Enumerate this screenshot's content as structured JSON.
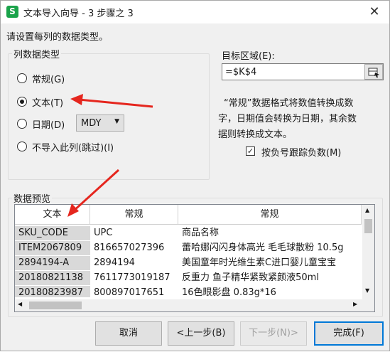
{
  "window": {
    "title": "文本导入向导 - 3 步骤之 3",
    "app_icon_letter": "S",
    "close_glyph": "✕"
  },
  "instruction": "请设置每列的数据类型。",
  "column_type": {
    "legend": "列数据类型",
    "options": [
      {
        "label": "常规(G)",
        "checked": false
      },
      {
        "label": "文本(T)",
        "checked": true
      },
      {
        "label": "日期(D)",
        "checked": false
      },
      {
        "label": "不导入此列(跳过)(I)",
        "checked": false
      }
    ],
    "date_format": "MDY"
  },
  "target": {
    "label": "目标区域(E):",
    "value": "=$K$4"
  },
  "description": [
    "“常规”数据格式将数值转换成数",
    "字，日期值会转换为日期，其余数",
    "据则转换成文本。"
  ],
  "negative_option": {
    "label": "按负号跟踪负数(M)",
    "checked": true,
    "check_glyph": "✓"
  },
  "preview": {
    "legend": "数据预览",
    "headers": [
      "文本",
      "常规",
      "常规"
    ],
    "rows": [
      [
        "SKU_CODE",
        "UPC",
        "商品名称"
      ],
      [
        "ITEM2067809",
        "816657027396",
        "蕾哈娜闪闪身体高光 毛毛球散粉 10.5g"
      ],
      [
        "2894194-A",
        "2894194",
        "美国童年时光维生素C进口婴儿童宝宝"
      ],
      [
        "20180821138",
        "7611773019187",
        "反重力 鱼子精华紧致紧颜液50ml"
      ],
      [
        "20180823987",
        "800897017651",
        "16色眼影盘 0.83g*16"
      ]
    ]
  },
  "buttons": {
    "cancel": "取消",
    "back": "<上一步(B)",
    "next": "下一步(N)>",
    "finish": "完成(F)"
  },
  "colors": {
    "annotation_arrow": "#e5261e",
    "focus_border": "#0078d7",
    "app_icon": "#1aa34a"
  }
}
